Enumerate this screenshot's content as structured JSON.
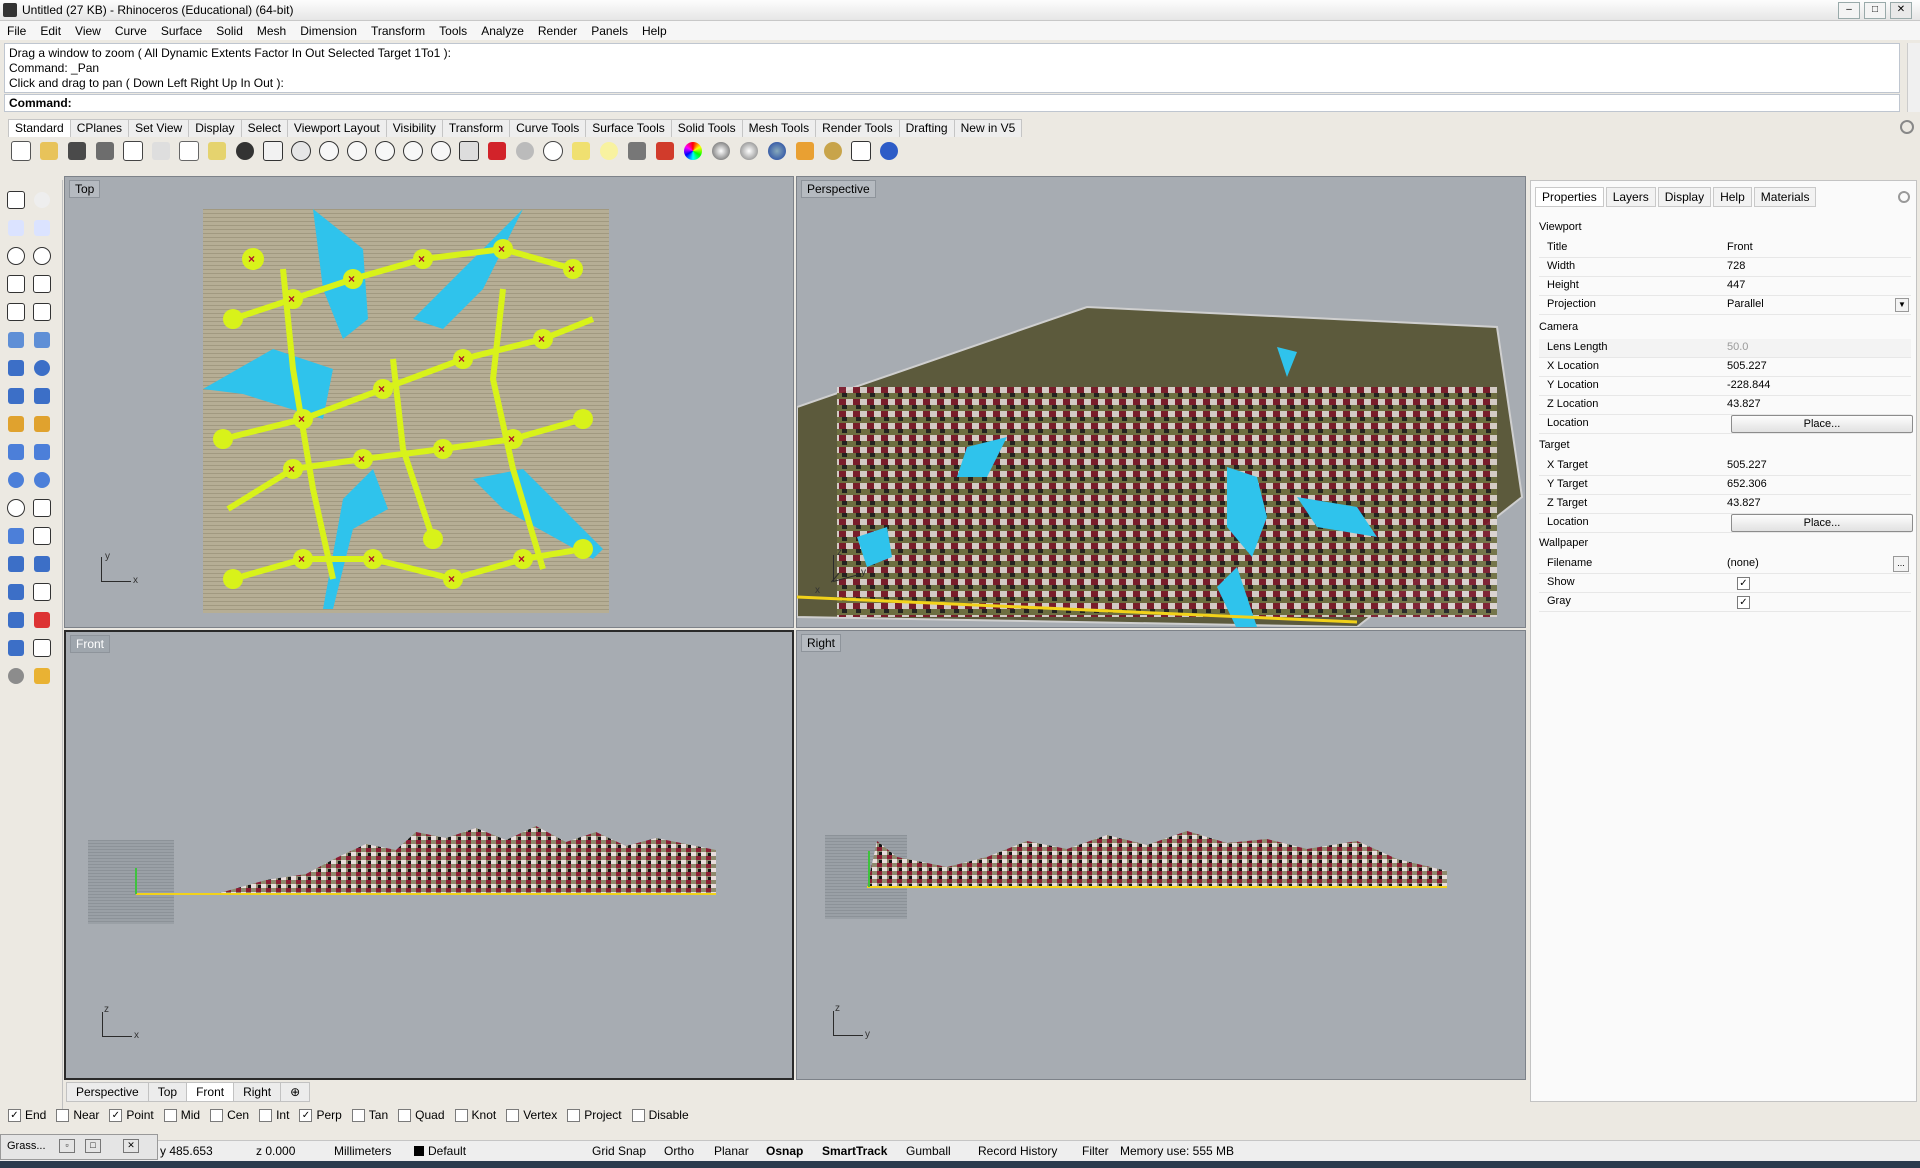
{
  "window": {
    "title": "Untitled (27 KB) - Rhinoceros (Educational) (64-bit)"
  },
  "menu": [
    "File",
    "Edit",
    "View",
    "Curve",
    "Surface",
    "Solid",
    "Mesh",
    "Dimension",
    "Transform",
    "Tools",
    "Analyze",
    "Render",
    "Panels",
    "Help"
  ],
  "command_history": [
    "Drag a window to zoom ( All  Dynamic  Extents  Factor  In  Out  Selected  Target  1To1 ):",
    "Command: _Pan",
    "Click and drag to pan ( Down  Left  Right  Up  In  Out ):"
  ],
  "command_prompt": "Command:",
  "toolbar_tabs": [
    "Standard",
    "CPlanes",
    "Set View",
    "Display",
    "Select",
    "Viewport Layout",
    "Visibility",
    "Transform",
    "Curve Tools",
    "Surface Tools",
    "Solid Tools",
    "Mesh Tools",
    "Render Tools",
    "Drafting",
    "New in V5"
  ],
  "toolbar_icons": [
    "new-icon",
    "open-icon",
    "save-icon",
    "print-icon",
    "import-icon",
    "cut-icon",
    "copy-icon",
    "paste-icon",
    "undo-icon",
    "pan-icon",
    "rotate-icon",
    "zoom-window-icon",
    "zoom-extents-icon",
    "zoom-selected-icon",
    "zoom-icon",
    "rotate-view-icon",
    "grid-icon",
    "car-icon",
    "sphere-icon",
    "circle-icon",
    "snap-icon",
    "light-icon",
    "lock-icon",
    "layer-icon",
    "color-wheel-icon",
    "render-preview-icon",
    "material-icon",
    "sphere-blue-icon",
    "texture-icon",
    "gear-icon",
    "tools-icon",
    "help-icon"
  ],
  "viewports": {
    "top": {
      "label": "Top",
      "axis1": "y",
      "axis2": "x"
    },
    "perspective": {
      "label": "Perspective",
      "axis1": "z",
      "axis2": "y",
      "axis3": "x"
    },
    "front": {
      "label": "Front",
      "axis1": "z",
      "axis2": "x"
    },
    "right": {
      "label": "Right",
      "axis1": "z",
      "axis2": "y"
    }
  },
  "viewport_tabs": [
    "Perspective",
    "Top",
    "Front",
    "Right",
    "⊕"
  ],
  "properties_panel": {
    "tabs": [
      "Properties",
      "Layers",
      "Display",
      "Help",
      "Materials"
    ],
    "sections": {
      "viewport": "Viewport",
      "camera": "Camera",
      "target": "Target",
      "wallpaper": "Wallpaper"
    },
    "rows": {
      "title": {
        "k": "Title",
        "v": "Front"
      },
      "width": {
        "k": "Width",
        "v": "728"
      },
      "height": {
        "k": "Height",
        "v": "447"
      },
      "projection": {
        "k": "Projection",
        "v": "Parallel"
      },
      "lens": {
        "k": "Lens Length",
        "v": "50.0"
      },
      "xloc": {
        "k": "X Location",
        "v": "505.227"
      },
      "yloc": {
        "k": "Y Location",
        "v": "-228.844"
      },
      "zloc": {
        "k": "Z Location",
        "v": "43.827"
      },
      "loc": {
        "k": "Location",
        "v": "Place..."
      },
      "xt": {
        "k": "X Target",
        "v": "505.227"
      },
      "yt": {
        "k": "Y Target",
        "v": "652.306"
      },
      "zt": {
        "k": "Z Target",
        "v": "43.827"
      },
      "tloc": {
        "k": "Location",
        "v": "Place..."
      },
      "filename": {
        "k": "Filename",
        "v": "(none)"
      },
      "show": {
        "k": "Show",
        "checked": true
      },
      "gray": {
        "k": "Gray",
        "checked": true
      },
      "browse": "..."
    }
  },
  "osnap": [
    {
      "label": "End",
      "checked": true
    },
    {
      "label": "Near",
      "checked": false
    },
    {
      "label": "Point",
      "checked": true
    },
    {
      "label": "Mid",
      "checked": false
    },
    {
      "label": "Cen",
      "checked": false
    },
    {
      "label": "Int",
      "checked": false
    },
    {
      "label": "Perp",
      "checked": true
    },
    {
      "label": "Tan",
      "checked": false
    },
    {
      "label": "Quad",
      "checked": false
    },
    {
      "label": "Knot",
      "checked": false
    },
    {
      "label": "Vertex",
      "checked": false
    },
    {
      "label": "Project",
      "checked": false
    },
    {
      "label": "Disable",
      "checked": false
    }
  ],
  "status": {
    "mini_window": "Grass...",
    "y": "y 485.653",
    "z": "z 0.000",
    "units": "Millimeters",
    "layer": "Default",
    "grid_snap": "Grid Snap",
    "ortho": "Ortho",
    "planar": "Planar",
    "osnap": "Osnap",
    "smarttrack": "SmartTrack",
    "gumball": "Gumball",
    "record_history": "Record History",
    "filter": "Filter",
    "memory": "Memory use: 555 MB"
  },
  "colors": {
    "viewport_bg": "#a7acb2",
    "water": "#2fc3ec",
    "paths": "#d8f21a",
    "marker": "#b0102c",
    "ground": "#8a7b4f"
  }
}
